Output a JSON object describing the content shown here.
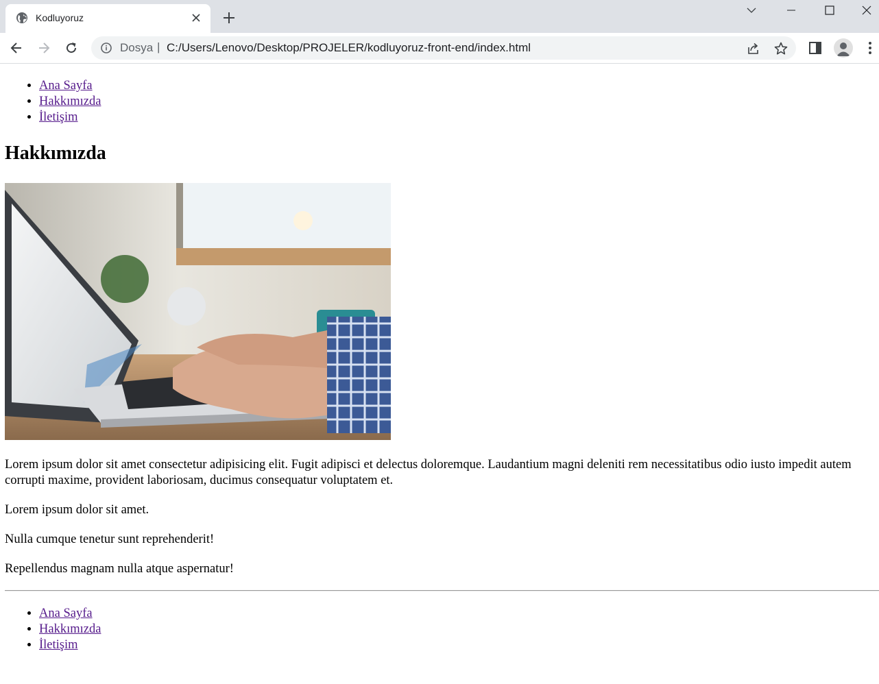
{
  "browser": {
    "tab": {
      "title": "Kodluyoruz",
      "favicon": "globe-icon"
    },
    "address": {
      "scheme_label": "Dosya",
      "separator": "|",
      "url": "C:/Users/Lenovo/Desktop/PROJELER/kodluyoruz-front-end/index.html"
    },
    "icons": [
      "globe-icon",
      "close-icon",
      "plus-icon",
      "chevron-down-icon",
      "minimize-icon",
      "maximize-icon",
      "window-close-icon",
      "back-arrow-icon",
      "forward-arrow-icon",
      "reload-icon",
      "info-icon",
      "share-icon",
      "star-icon",
      "side-panel-icon",
      "profile-icon",
      "kebab-menu-icon"
    ]
  },
  "page": {
    "nav_top": [
      "Ana Sayfa",
      "Hakkımızda",
      "İletişim"
    ],
    "heading": "Hakkımızda",
    "paragraphs": [
      "Lorem ipsum dolor sit amet consectetur adipisicing elit. Fugit adipisci et delectus doloremque. Laudantium magni deleniti rem necessitatibus odio iusto impedit autem corrupti maxime, provident laboriosam, ducimus consequatur voluptatem et.",
      "Lorem ipsum dolor sit amet.",
      "Nulla cumque tenetur sunt reprehenderit!",
      "Repellendus magnam nulla atque aspernatur!"
    ],
    "nav_bottom": [
      "Ana Sayfa",
      "Hakkımızda",
      "İletişim"
    ]
  },
  "colors": {
    "tabstrip_bg": "#dee1e6",
    "omnibox_bg": "#f1f3f4",
    "link_visited": "#551a8b"
  }
}
